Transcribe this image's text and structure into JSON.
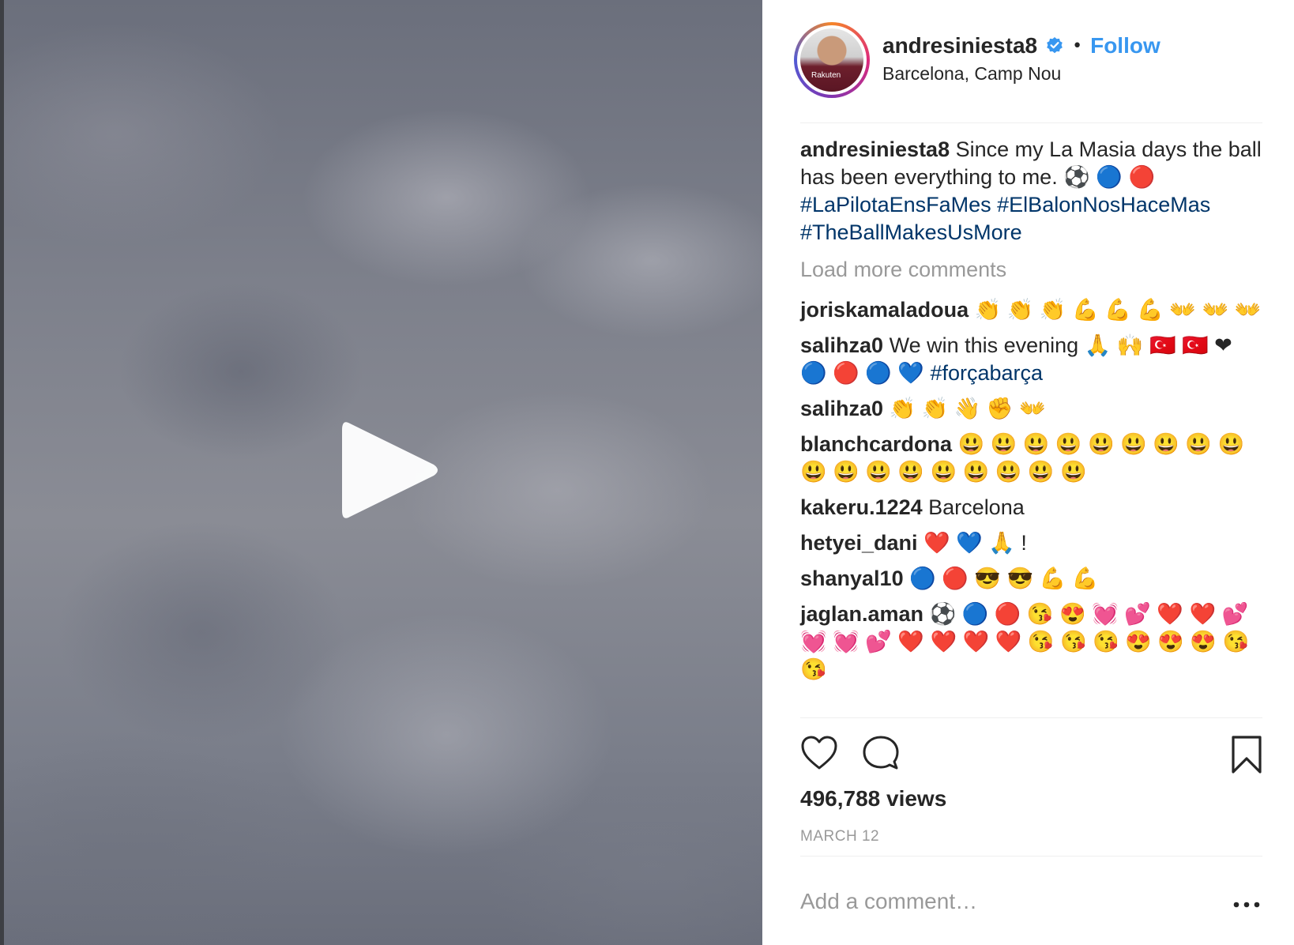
{
  "post": {
    "username": "andresiniesta8",
    "follow_label": "Follow",
    "separator": "•",
    "location": "Barcelona, Camp Nou",
    "avatar_text": "Rakuten"
  },
  "caption": {
    "user": "andresiniesta8",
    "text": "Since my La Masia days the ball has been everything to me. ⚽ 🔵 🔴",
    "hashtags": [
      "#LaPilotaEnsFaMes",
      "#ElBalonNosHaceMas",
      "#TheBallMakesUsMore"
    ]
  },
  "load_more_label": "Load more comments",
  "comments": [
    {
      "user": "joriskamaladoua",
      "text": "👏 👏 👏 💪 💪 💪 👐 👐 👐"
    },
    {
      "user": "salihza0",
      "text": "We win this evening 🙏 🙌 🇹🇷 🇹🇷 ❤ 🔵 🔴 🔵 💙 ",
      "tag": "#forçabarça"
    },
    {
      "user": "salihza0",
      "text": "👏 👏 👋 ✊ 👐"
    },
    {
      "user": "blanchcardona",
      "text": "😃 😃 😃 😃 😃 😃 😃 😃 😃 😃 😃 😃 😃 😃 😃 😃 😃 😃"
    },
    {
      "user": "kakeru.1224",
      "text": "Barcelona"
    },
    {
      "user": "hetyei_dani",
      "text": "❤️ 💙 🙏 !"
    },
    {
      "user": "shanyal10",
      "text": "🔵 🔴 😎 😎 💪 💪"
    },
    {
      "user": "jaglan.aman",
      "text": "⚽ 🔵 🔴 😘 😍 💓 💕 ❤️ ❤️ 💕 💓 💓 💕 ❤️ ❤️ ❤️ ❤️ 😘 😘 😘 😍 😍 😍 😘 😘"
    }
  ],
  "stats": {
    "views": "496,788 views",
    "date": "MARCH 12"
  },
  "add_comment_placeholder": "Add a comment…",
  "icons": {
    "play": "play-icon",
    "verified": "verified-badge-icon",
    "like": "heart-icon",
    "comment": "speech-bubble-icon",
    "save": "bookmark-icon",
    "more": "ellipsis-icon"
  },
  "colors": {
    "link": "#3897f0",
    "hashtag": "#003569",
    "muted": "#999999"
  }
}
